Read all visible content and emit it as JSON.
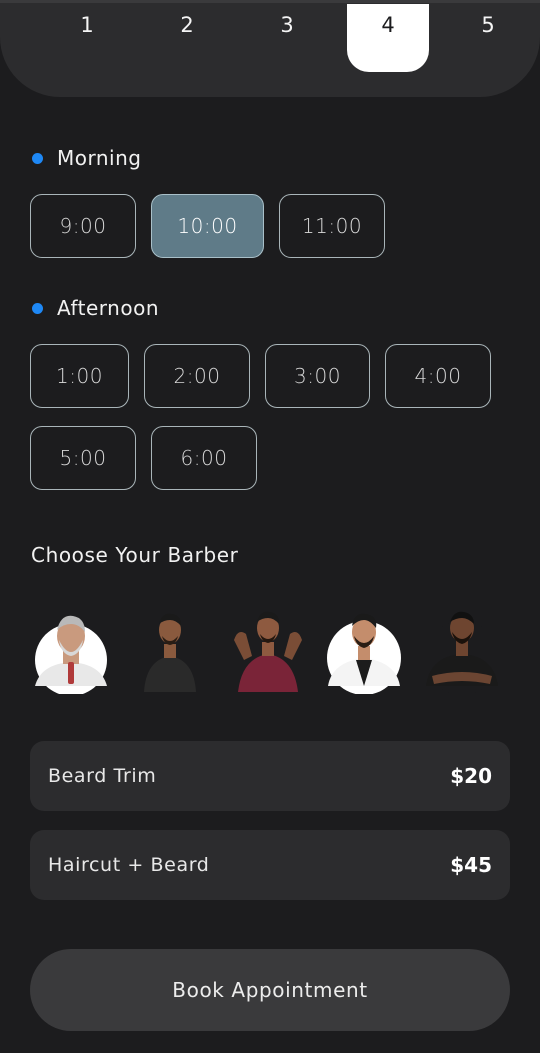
{
  "days": {
    "items": [
      "1",
      "2",
      "3",
      "4",
      "5"
    ],
    "selected_index": 3
  },
  "morning": {
    "label": "Morning",
    "slots": [
      "9:00",
      "10:00",
      "11:00"
    ],
    "selected": "10:00"
  },
  "afternoon": {
    "label": "Afternoon",
    "slots": [
      "1:00",
      "2:00",
      "3:00",
      "4:00",
      "5:00",
      "6:00"
    ]
  },
  "barbers": {
    "title": "Choose Your Barber",
    "items": [
      {
        "icon": "barber-1-avatar",
        "shirt": "#e8e8e8",
        "bg": "#ffffff"
      },
      {
        "icon": "barber-2-avatar",
        "shirt": "#2a2a2a",
        "bg": "#1c1c1e"
      },
      {
        "icon": "barber-3-avatar",
        "shirt": "#7a2438",
        "bg": "#1c1c1e"
      },
      {
        "icon": "barber-4-avatar",
        "shirt": "#f4f4f4",
        "bg": "#ffffff"
      },
      {
        "icon": "barber-5-avatar",
        "shirt": "#1a1a1a",
        "bg": "#1c1c1e"
      }
    ]
  },
  "services": [
    {
      "name": "Beard Trim",
      "price": "$20"
    },
    {
      "name": "Haircut + Beard",
      "price": "$45"
    }
  ],
  "book_button": {
    "label": "Book Appointment"
  },
  "colors": {
    "background": "#1c1c1e",
    "surface": "#2c2c2e",
    "accent_dot": "#1e88f5",
    "selected_slot": "#5f7b88"
  }
}
